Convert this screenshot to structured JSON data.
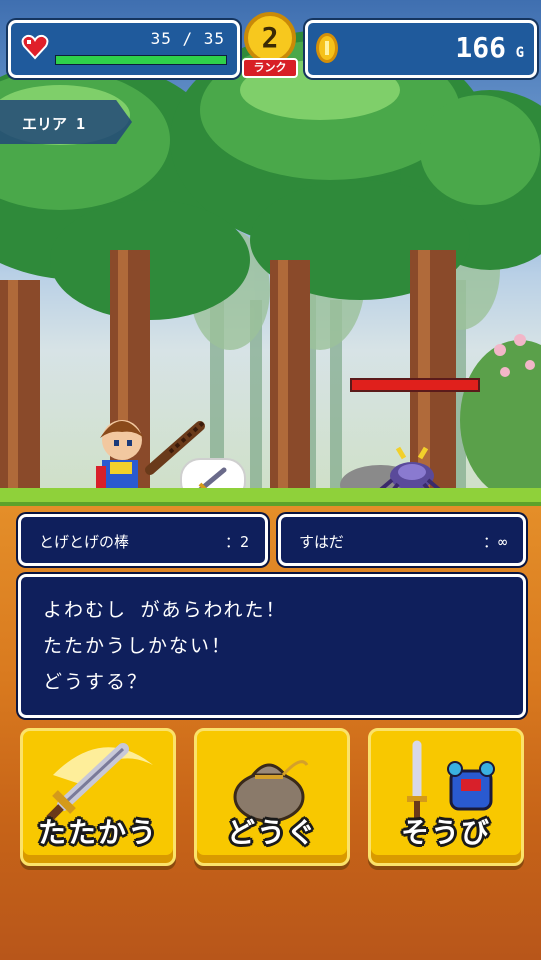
{
  "hud": {
    "hp_text": "35 / 35",
    "hp_current": 35,
    "hp_max": 35,
    "rank_number": "2",
    "rank_label": "ランク",
    "gold_value": "166",
    "gold_unit": "G"
  },
  "area": {
    "label": "エリア 1"
  },
  "enemy": {
    "hp_fraction": 1.0
  },
  "equipment": {
    "weapon_name": "とげとげの棒",
    "weapon_count": "：2",
    "armor_name": "すはだ",
    "armor_count": "：∞"
  },
  "message": {
    "line1": "よわむし があらわれた！",
    "line2": "たたかうしかない！",
    "line3": "どうする？"
  },
  "commands": {
    "attack": "たたかう",
    "item": "どうぐ",
    "equip": "そうび"
  },
  "colors": {
    "hp_fill": "#2fd14a",
    "enemy_hp_fill": "#e0201c",
    "button_yellow": "#f8c800",
    "panel_navy": "#0f1f5c"
  }
}
